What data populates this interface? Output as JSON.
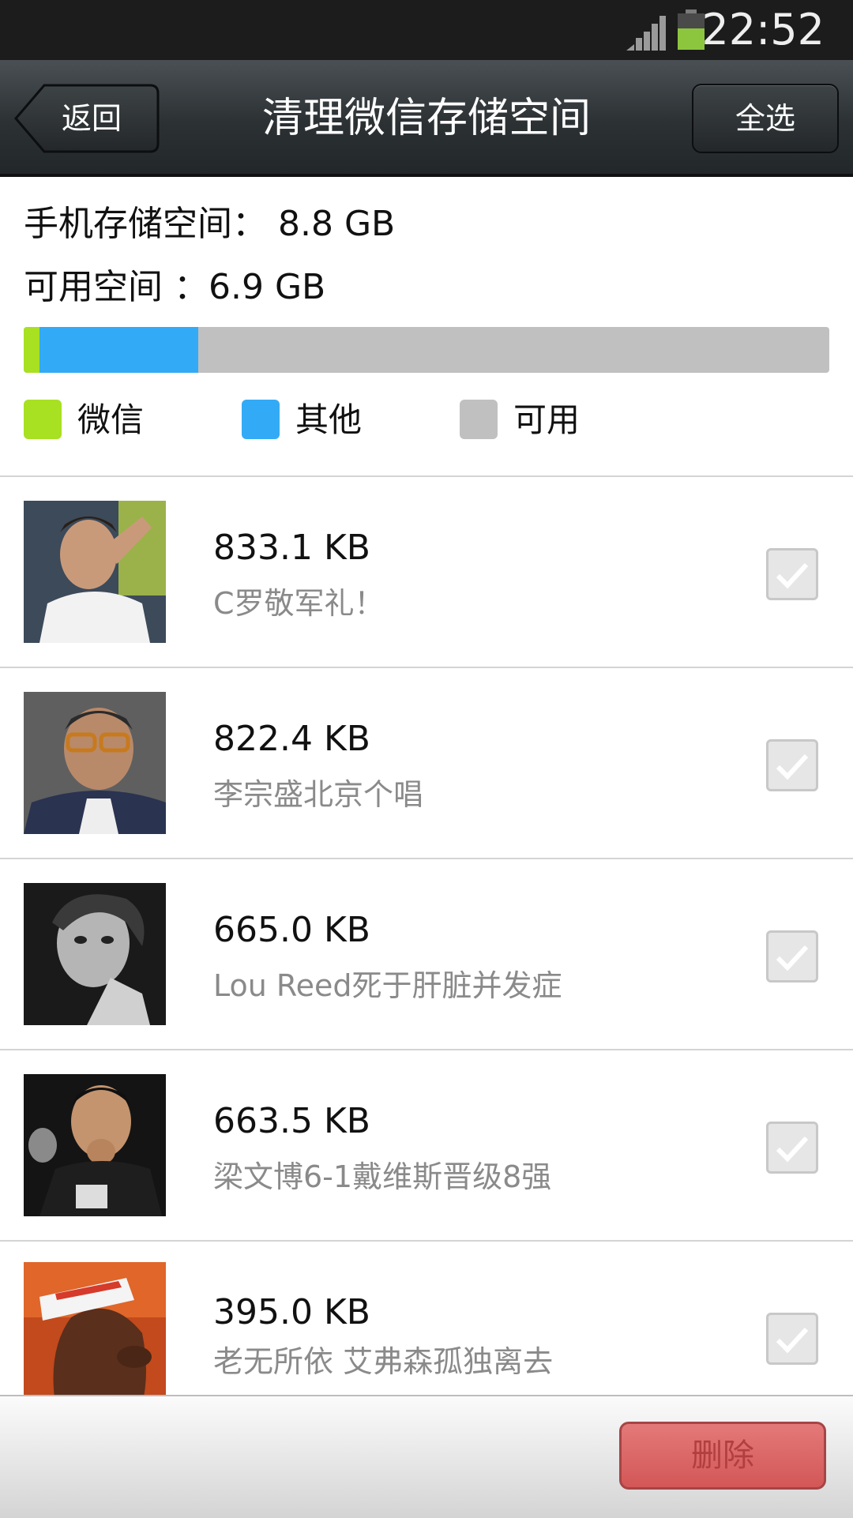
{
  "status_bar": {
    "time": "22:52"
  },
  "header": {
    "back_label": "返回",
    "title": "清理微信存储空间",
    "select_all_label": "全选"
  },
  "storage": {
    "total_label": "手机存储空间：",
    "total_value": "8.8 GB",
    "available_label": "可用空间 ：",
    "available_value": "6.9 GB",
    "usage_fractions": {
      "wechat": 0.02,
      "other": 0.197,
      "available": 0.783
    },
    "legend": [
      {
        "label": "微信",
        "color": "#a8e022"
      },
      {
        "label": "其他",
        "color": "#33aaf5"
      },
      {
        "label": "可用",
        "color": "#c0c0c0"
      }
    ]
  },
  "items": [
    {
      "size": "833.1 KB",
      "caption": "C罗敬军礼！",
      "checked": true,
      "thumbnail": "ronaldo-salute-photo"
    },
    {
      "size": "822.4 KB",
      "caption": "李宗盛北京个唱",
      "checked": true,
      "thumbnail": "man-with-glasses-photo"
    },
    {
      "size": "665.0 KB",
      "caption": "Lou Reed死于肝脏并发症",
      "checked": true,
      "thumbnail": "bw-portrait-photo"
    },
    {
      "size": "663.5 KB",
      "caption": "梁文博6-1戴维斯晋级8强",
      "checked": true,
      "thumbnail": "snooker-player-photo"
    },
    {
      "size": "395.0 KB",
      "caption": "老无所依 艾弗森孤独离去",
      "checked": true,
      "thumbnail": "headband-profile-photo"
    }
  ],
  "footer": {
    "delete_label": "删除"
  }
}
